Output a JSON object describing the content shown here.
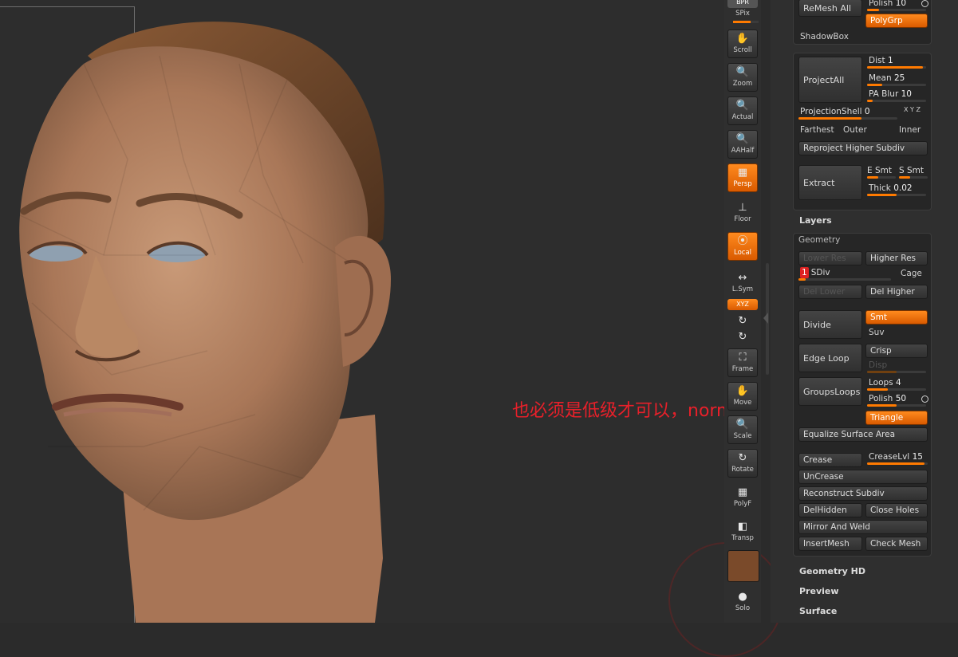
{
  "annotation": "也必须是低级才可以，normal",
  "shelf": {
    "top_label": "BPR",
    "spix": "SPix",
    "tools": [
      {
        "label": "Scroll",
        "icon": "✋"
      },
      {
        "label": "Zoom",
        "icon": "🔍"
      },
      {
        "label": "Actual",
        "icon": "🔍"
      },
      {
        "label": "AAHalf",
        "icon": "🔍"
      },
      {
        "label": "Persp",
        "icon": "▦"
      },
      {
        "label": "Floor",
        "icon": "⊥"
      },
      {
        "label": "Local",
        "icon": "⦿"
      },
      {
        "label": "L.Sym",
        "icon": "↔"
      },
      {
        "label": "XYZ",
        "icon": ""
      },
      {
        "label": "Frame",
        "icon": "⛶"
      },
      {
        "label": "Move",
        "icon": "✋"
      },
      {
        "label": "Scale",
        "icon": "🔍"
      },
      {
        "label": "Rotate",
        "icon": "↻"
      },
      {
        "label": "PolyF",
        "icon": "▦"
      },
      {
        "label": "Transp",
        "icon": "◧"
      },
      {
        "label": "Solo",
        "icon": "●"
      }
    ]
  },
  "palette": {
    "remesh_all": "ReMesh All",
    "polish": {
      "label": "Polish",
      "value": "10",
      "fill": 0.2
    },
    "polygrp": "PolyGrp",
    "shadowbox": "ShadowBox",
    "project_all": "ProjectAll",
    "dist": {
      "label": "Dist",
      "value": "1",
      "fill": 0.95
    },
    "mean": {
      "label": "Mean",
      "value": "25",
      "fill": 0.25
    },
    "pa_blur": {
      "label": "PA Blur",
      "value": "10",
      "fill": 0.1
    },
    "projection_shell": {
      "label": "ProjectionShell",
      "value": "0",
      "fill": 0.5
    },
    "xyz_small": "X Y Z",
    "farthest": "Farthest",
    "outer": "Outer",
    "inner": "Inner",
    "reproject": "Reproject Higher Subdiv",
    "extract": "Extract",
    "e_smt": "E Smt",
    "s_smt": "S Smt",
    "thick": {
      "label": "Thick",
      "value": "0.02",
      "fill": 0.5
    },
    "layers": "Layers",
    "geometry": "Geometry",
    "lower_res": "Lower Res",
    "higher_res": "Higher Res",
    "sdiv": {
      "badge": "1",
      "label": "SDiv",
      "fill": 0.05
    },
    "cage": "Cage",
    "del_lower": "Del Lower",
    "del_higher": "Del Higher",
    "divide": "Divide",
    "smt": "Smt",
    "suv": "Suv",
    "edge_loop": "Edge Loop",
    "crisp": "Crisp",
    "disp": "Disp",
    "groups_loops": "GroupsLoops",
    "loops": {
      "label": "Loops",
      "value": "4",
      "fill": 0.35
    },
    "polish2": {
      "label": "Polish",
      "value": "50",
      "fill": 0.5
    },
    "triangle": "Triangle",
    "equalize": "Equalize Surface Area",
    "crease": "Crease",
    "crease_lvl": {
      "label": "CreaseLvl",
      "value": "15",
      "fill": 0.95
    },
    "uncrease": "UnCrease",
    "reconstruct": "Reconstruct Subdiv",
    "del_hidden": "DelHidden",
    "close_holes": "Close Holes",
    "mirror_weld": "Mirror And Weld",
    "insert_mesh": "InsertMesh",
    "check_mesh": "Check Mesh",
    "geometry_hd": "Geometry HD",
    "preview": "Preview",
    "surface": "Surface"
  },
  "colors": {
    "accent": "#ff7a00",
    "annotation": "#e8202a",
    "background": "#2b2b2b"
  }
}
